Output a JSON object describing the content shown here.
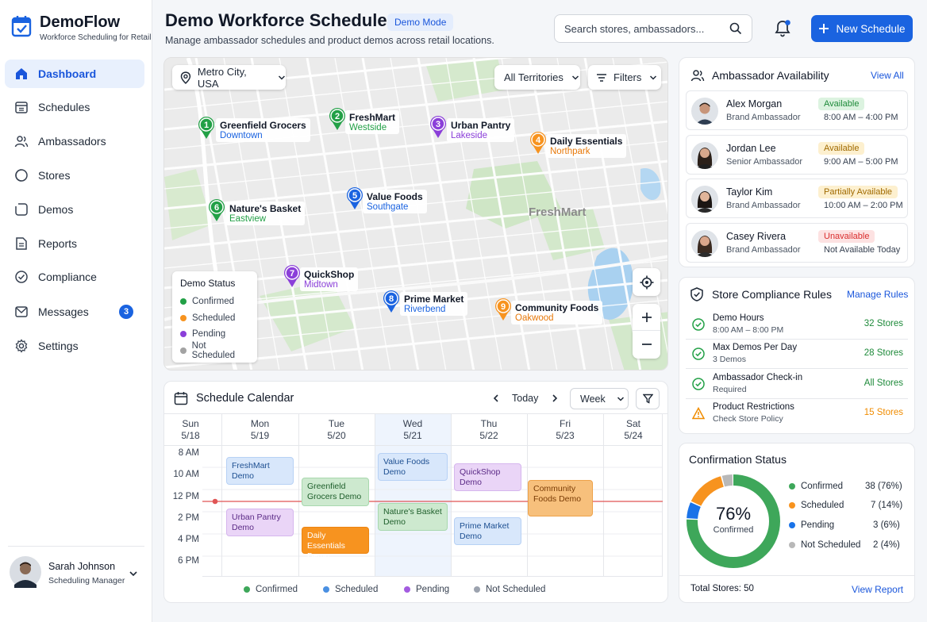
{
  "app": {
    "title": "DemoFlow",
    "subtitle": "Workforce Scheduling for Retail"
  },
  "sidebar": {
    "items": [
      {
        "label": "Dashboard",
        "icon": "home-icon"
      },
      {
        "label": "Schedules",
        "icon": "calendar-icon"
      },
      {
        "label": "Ambassadors",
        "icon": "users-icon"
      },
      {
        "label": "Stores",
        "icon": "store-icon"
      },
      {
        "label": "Demos",
        "icon": "demo-icon"
      },
      {
        "label": "Reports",
        "icon": "report-icon"
      },
      {
        "label": "Compliance",
        "icon": "check-circle-icon"
      },
      {
        "label": "Messages",
        "icon": "message-icon",
        "badge": "3"
      },
      {
        "label": "Settings",
        "icon": "gear-icon"
      }
    ],
    "user": {
      "name": "Sarah Johnson",
      "role": "Scheduling Manager"
    }
  },
  "header": {
    "title": "Demo Workforce Scheduler",
    "mode_badge": "Demo Mode",
    "subtitle": "Manage ambassador schedules and product demos across retail locations.",
    "search_placeholder": "Search stores, ambassadors...",
    "new_button": "New Schedule"
  },
  "map": {
    "location": "Metro City, USA",
    "territories": "All Territories",
    "filters": "Filters",
    "watermark": "FreshMart",
    "pins": [
      {
        "num": "1",
        "name": "Greenfield Grocers",
        "area": "Downtown",
        "status": "confirmed"
      },
      {
        "num": "2",
        "name": "FreshMart",
        "area": "Westside",
        "status": "confirmed"
      },
      {
        "num": "3",
        "name": "Urban Pantry",
        "area": "Lakeside",
        "status": "pending"
      },
      {
        "num": "4",
        "name": "Daily Essentials",
        "area": "Northpark",
        "status": "scheduled"
      },
      {
        "num": "5",
        "name": "Value Foods",
        "area": "Southgate",
        "status": "blue"
      },
      {
        "num": "6",
        "name": "Nature's Basket",
        "area": "Eastview",
        "status": "confirmed"
      },
      {
        "num": "7",
        "name": "QuickShop",
        "area": "Midtown",
        "status": "pending"
      },
      {
        "num": "8",
        "name": "Prime Market",
        "area": "Riverbend",
        "status": "blue"
      },
      {
        "num": "9",
        "name": "Community Foods",
        "area": "Oakwood",
        "status": "scheduled"
      }
    ],
    "legend": {
      "title": "Demo Status",
      "items": [
        {
          "label": "Confirmed",
          "color": "#22a046"
        },
        {
          "label": "Scheduled",
          "color": "#f7931f"
        },
        {
          "label": "Pending",
          "color": "#8b3fd9"
        },
        {
          "label": "Not Scheduled",
          "color": "#a3a3a3"
        }
      ]
    }
  },
  "calendar": {
    "title": "Schedule Calendar",
    "today": "Today",
    "view": "Week",
    "days": [
      {
        "dow": "Sun",
        "date": "5/18"
      },
      {
        "dow": "Mon",
        "date": "5/19"
      },
      {
        "dow": "Tue",
        "date": "5/20"
      },
      {
        "dow": "Wed",
        "date": "5/21"
      },
      {
        "dow": "Thu",
        "date": "5/22"
      },
      {
        "dow": "Fri",
        "date": "5/23"
      },
      {
        "dow": "Sat",
        "date": "5/24"
      }
    ],
    "times": [
      "8 AM",
      "10 AM",
      "12 PM",
      "2 PM",
      "4 PM",
      "6 PM"
    ],
    "events": [
      {
        "text": "FreshMart Demo"
      },
      {
        "text": "Urban Pantry Demo"
      },
      {
        "text": "Greenfield Grocers Demo"
      },
      {
        "text": "Daily Essentials Demo"
      },
      {
        "text": "Value Foods Demo"
      },
      {
        "text": "Nature's Basket Demo"
      },
      {
        "text": "QuickShop Demo"
      },
      {
        "text": "Prime Market Demo"
      },
      {
        "text": "Community Foods Demo"
      }
    ],
    "legend": [
      {
        "label": "Confirmed",
        "color": "#3ea75a"
      },
      {
        "label": "Scheduled",
        "color": "#4a90e2"
      },
      {
        "label": "Pending",
        "color": "#a35ce0"
      },
      {
        "label": "Not Scheduled",
        "color": "#9ca3af"
      }
    ]
  },
  "availability": {
    "title": "Ambassador Availability",
    "link": "View All",
    "people": [
      {
        "name": "Alex Morgan",
        "role": "Brand Ambassador",
        "status": "Available",
        "hours": "8:00 AM – 4:00 PM"
      },
      {
        "name": "Jordan Lee",
        "role": "Senior Ambassador",
        "status": "Available",
        "hours": "9:00 AM – 5:00 PM"
      },
      {
        "name": "Taylor Kim",
        "role": "Brand Ambassador",
        "status": "Partially Available",
        "hours": "10:00 AM – 2:00 PM"
      },
      {
        "name": "Casey Rivera",
        "role": "Brand Ambassador",
        "status": "Unavailable",
        "hours": "Not Available Today"
      }
    ]
  },
  "compliance": {
    "title": "Store Compliance Rules",
    "link": "Manage Rules",
    "rules": [
      {
        "title": "Demo Hours",
        "sub": "8:00 AM – 8:00 PM",
        "value": "32 Stores"
      },
      {
        "title": "Max Demos Per Day",
        "sub": "3 Demos",
        "value": "28 Stores"
      },
      {
        "title": "Ambassador Check-in",
        "sub": "Required",
        "value": "All Stores"
      },
      {
        "title": "Product Restrictions",
        "sub": "Check Store Policy",
        "value": "15 Stores"
      }
    ]
  },
  "confirmation": {
    "title": "Confirmation Status",
    "center_pct": "76%",
    "center_label": "Confirmed",
    "rows": [
      {
        "label": "Confirmed",
        "value": "38 (76%)",
        "count": 38,
        "color": "#3ea75a"
      },
      {
        "label": "Scheduled",
        "value": "7 (14%)",
        "count": 7,
        "color": "#f7931f"
      },
      {
        "label": "Pending",
        "value": "3 (6%)",
        "count": 3,
        "color": "#1a73e8"
      },
      {
        "label": "Not Scheduled",
        "value": "2 (4%)",
        "count": 2,
        "color": "#b8b8b8"
      }
    ],
    "total": "Total Stores: 50",
    "link": "View Report"
  }
}
